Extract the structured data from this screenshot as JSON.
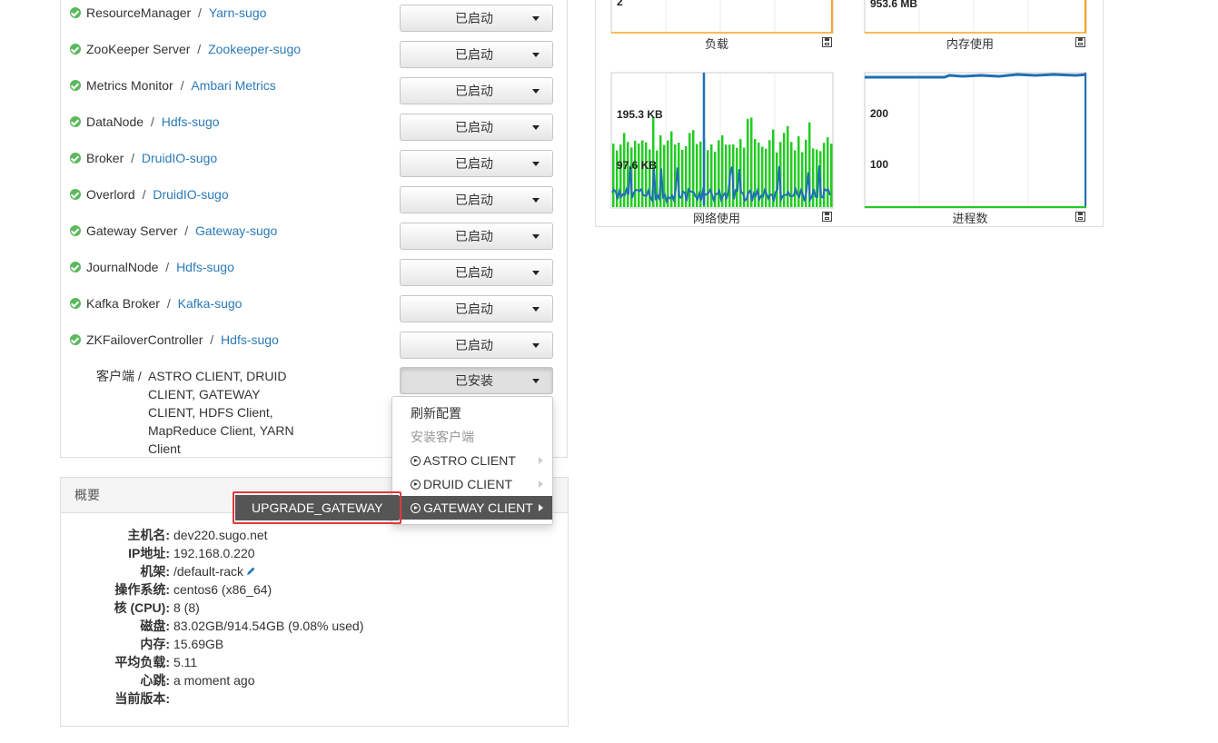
{
  "components": [
    {
      "name": "ResourceManager",
      "service": "Yarn-sugo",
      "status": "已启动"
    },
    {
      "name": "ZooKeeper Server",
      "service": "Zookeeper-sugo",
      "status": "已启动"
    },
    {
      "name": "Metrics Monitor",
      "service": "Ambari Metrics",
      "status": "已启动"
    },
    {
      "name": "DataNode",
      "service": "Hdfs-sugo",
      "status": "已启动"
    },
    {
      "name": "Broker",
      "service": "DruidIO-sugo",
      "status": "已启动"
    },
    {
      "name": "Overlord",
      "service": "DruidIO-sugo",
      "status": "已启动"
    },
    {
      "name": "Gateway Server",
      "service": "Gateway-sugo",
      "status": "已启动"
    },
    {
      "name": "JournalNode",
      "service": "Hdfs-sugo",
      "status": "已启动"
    },
    {
      "name": "Kafka Broker",
      "service": "Kafka-sugo",
      "status": "已启动"
    },
    {
      "name": "ZKFailoverController",
      "service": "Hdfs-sugo",
      "status": "已启动"
    }
  ],
  "clients": {
    "label": "客户端",
    "sep": "/",
    "list": "ASTRO CLIENT, DRUID CLIENT, GATEWAY CLIENT, HDFS Client, MapReduce Client, YARN Client",
    "status": "已安装"
  },
  "dropdown": {
    "refresh": "刷新配置",
    "install": "安装客户端",
    "items": [
      "ASTRO CLIENT",
      "DRUID CLIENT",
      "GATEWAY CLIENT"
    ],
    "submenu_item": "UPGRADE_GATEWAY"
  },
  "summary": {
    "title": "概要",
    "rows": [
      {
        "key": "主机名:",
        "value": "dev220.sugo.net"
      },
      {
        "key": "IP地址:",
        "value": "192.168.0.220"
      },
      {
        "key": "机架:",
        "value": "/default-rack"
      },
      {
        "key": "操作系统:",
        "value": "centos6 (x86_64)"
      },
      {
        "key": "核 (CPU):",
        "value": "8 (8)"
      },
      {
        "key": "磁盘:",
        "value": "83.02GB/914.54GB (9.08% used)"
      },
      {
        "key": "内存:",
        "value": "15.69GB"
      },
      {
        "key": "平均负载:",
        "value": "5.11"
      },
      {
        "key": "心跳:",
        "value": "a moment ago"
      },
      {
        "key": "当前版本:",
        "value": ""
      }
    ]
  },
  "metrics": {
    "load": {
      "title": "负载",
      "label": "2"
    },
    "memory": {
      "title": "内存使用",
      "label": "953.6 MB"
    },
    "network": {
      "title": "网络使用",
      "label_top": "195.3 KB",
      "label_mid": "97.6 KB"
    },
    "processes": {
      "title": "进程数",
      "label_top": "200",
      "label_mid": "100"
    }
  },
  "colors": {
    "accent": "#2a7ab7",
    "ok": "#5cb85c",
    "highlight_border": "#e0393b",
    "net_green": "#22cc22",
    "net_blue": "#1f6fb5"
  }
}
